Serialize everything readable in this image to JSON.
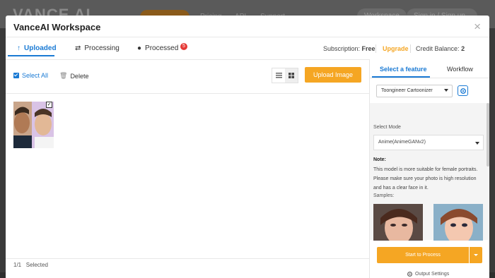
{
  "background": {
    "logo": "VANCE AI",
    "nav_pill": "AI Solutions",
    "nav_links": [
      "Pricing",
      "API",
      "Support"
    ],
    "workspace_btn": "Workspace",
    "signin_btn": "Sign in / Sign up"
  },
  "modal": {
    "title": "VanceAI Workspace",
    "close": "×"
  },
  "tabs": {
    "uploaded": "Uploaded",
    "processing": "Processing",
    "processed": "Processed",
    "processed_badge": "5"
  },
  "account": {
    "subscription_label": "Subscription:",
    "subscription_value": "Free",
    "upgrade": "Upgrade",
    "credit_label": "Credit Balance:",
    "credit_value": "2"
  },
  "toolbar": {
    "select_all": "Select All",
    "delete": "Delete",
    "upload": "Upload Image"
  },
  "footer": {
    "count": "1/1",
    "selected": "Selected"
  },
  "panel": {
    "tab_feature": "Select a feature",
    "tab_workflow": "Workflow",
    "feature_value": "Toongineer Cartoonizer",
    "mode_label": "Select Mode",
    "mode_value": "Anime(AnimeGANv2)",
    "note_title": "Note:",
    "note_text": "This model is more suitable for female portraits. Please make sure your photo is high resolution and has a clear face in it.",
    "samples_label": "Samples:",
    "start_btn": "Start to Process",
    "output_settings": "Output Settings"
  },
  "colors": {
    "accent_blue": "#1a7ad4",
    "accent_orange": "#f5a623",
    "badge_red": "#e53935"
  }
}
